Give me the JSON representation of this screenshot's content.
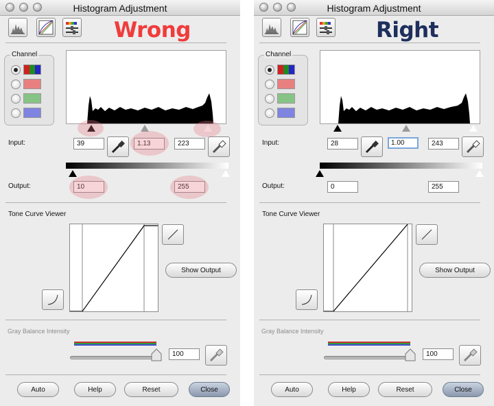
{
  "windows": [
    {
      "title": "Histogram Adjustment",
      "heading": "Wrong",
      "heading_color": "#f03c3c",
      "channel_label": "Channel",
      "channels": [
        "rgb",
        "red",
        "green",
        "blue"
      ],
      "selected_channel": "rgb",
      "input_label": "Input:",
      "input_black": "39",
      "input_gamma": "1.13",
      "input_white": "223",
      "output_label": "Output:",
      "output_black": "10",
      "output_white": "255",
      "tone_curve_label": "Tone Curve Viewer",
      "show_output_label": "Show Output",
      "gray_balance_label": "Gray Balance Intensity",
      "gray_balance_value": "100",
      "buttons": {
        "auto": "Auto",
        "help": "Help",
        "reset": "Reset",
        "close": "Close"
      },
      "highlighted_fields": true
    },
    {
      "title": "Histogram Adjustment",
      "heading": "Right",
      "heading_color": "#1e2f5c",
      "channel_label": "Channel",
      "channels": [
        "rgb",
        "red",
        "green",
        "blue"
      ],
      "selected_channel": "rgb",
      "input_label": "Input:",
      "input_black": "28",
      "input_gamma": "1.00",
      "input_white": "243",
      "output_label": "Output:",
      "output_black": "0",
      "output_white": "255",
      "tone_curve_label": "Tone Curve Viewer",
      "show_output_label": "Show Output",
      "gray_balance_label": "Gray Balance Intensity",
      "gray_balance_value": "100",
      "buttons": {
        "auto": "Auto",
        "help": "Help",
        "reset": "Reset",
        "close": "Close"
      },
      "highlighted_fields": false
    }
  ],
  "icons": [
    "histogram-icon",
    "curve-icon",
    "color-balance-icon",
    "eyedropper-icon",
    "tone-line-icon",
    "tone-curve-icon"
  ],
  "colors": {
    "channel_red": "#e88080",
    "channel_green": "#86c486",
    "channel_blue": "#7f84e0",
    "highlight": "#e67882"
  }
}
